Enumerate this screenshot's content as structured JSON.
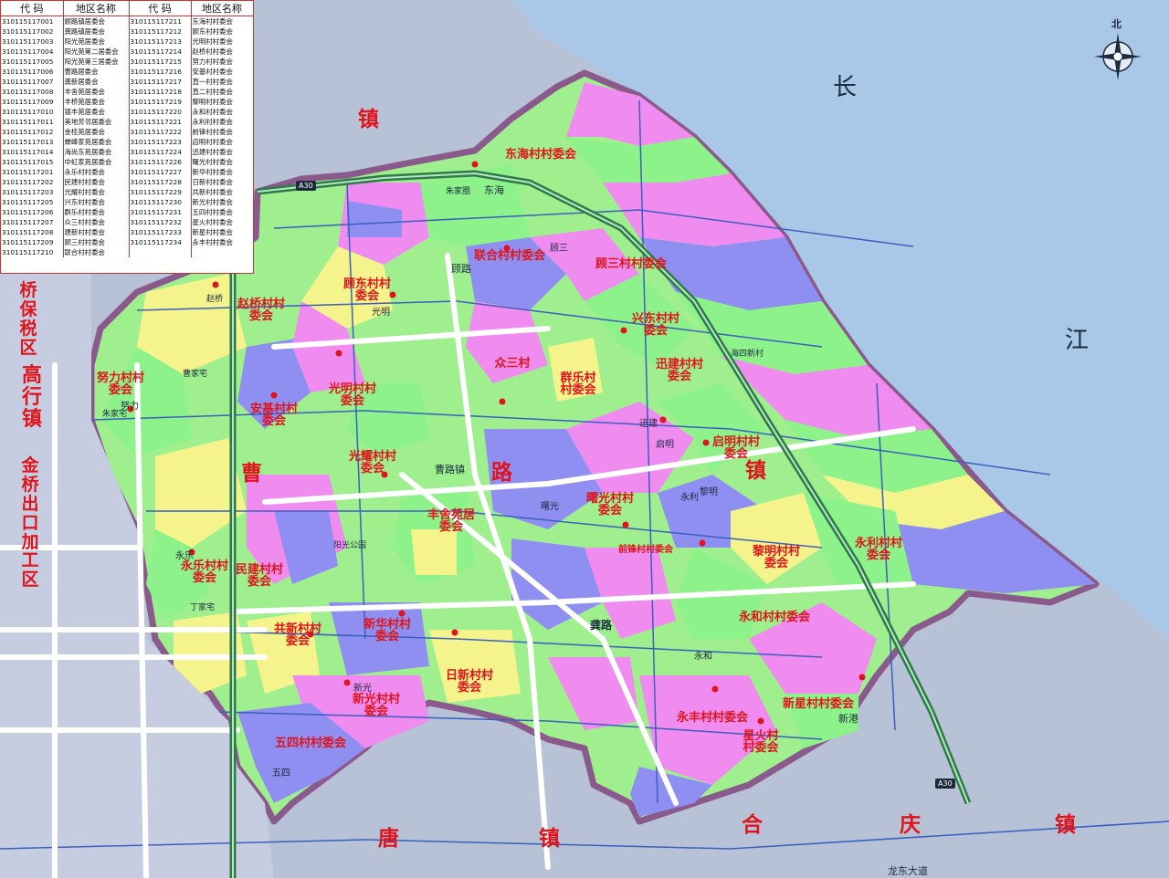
{
  "legend": {
    "headers": [
      "代 码",
      "地区名称",
      "代 码",
      "地区名称"
    ],
    "rows": [
      [
        "310115117001",
        "顾路镇居委会",
        "310115117211",
        "东海村村委会"
      ],
      [
        "310115117002",
        "龚路镇居委会",
        "310115117212",
        "顾东村村委会"
      ],
      [
        "310115117003",
        "阳光苑居委会",
        "310115117213",
        "光明村村委会"
      ],
      [
        "310115117004",
        "阳光苑第二居委会",
        "310115117214",
        "赵桥村村委会"
      ],
      [
        "310115117005",
        "阳光苑第三居委会",
        "310115117215",
        "努力村村委会"
      ],
      [
        "310115117006",
        "曹路居委会",
        "310115117216",
        "安基村村委会"
      ],
      [
        "310115117007",
        "龚新居委会",
        "310115117217",
        "直一村村委会"
      ],
      [
        "310115117008",
        "丰舍苑居委会",
        "310115117218",
        "直二村村委会"
      ],
      [
        "310115117009",
        "丰桥苑居委会",
        "310115117219",
        "黎明村村委会"
      ],
      [
        "310115117010",
        "银丰苑居委会",
        "310115117220",
        "永和村村委会"
      ],
      [
        "310115117011",
        "美地芳邻居委会",
        "310115117221",
        "永利村村委会"
      ],
      [
        "310115117012",
        "金桂苑居委会",
        "310115117222",
        "前锋村村委会"
      ],
      [
        "310115117013",
        "蝉峰家苑居委会",
        "310115117223",
        "启明村村委会"
      ],
      [
        "310115117014",
        "海尚东苑居委会",
        "310115117224",
        "迅建村村委会"
      ],
      [
        "310115117015",
        "中虹家苑居委会",
        "310115117226",
        "曙光村村委会"
      ],
      [
        "310115117201",
        "永乐村村委会",
        "310115117227",
        "新华村村委会"
      ],
      [
        "310115117202",
        "民建村村委会",
        "310115117228",
        "日新村村委会"
      ],
      [
        "310115117203",
        "光耀村村委会",
        "310115117229",
        "共新村村委会"
      ],
      [
        "310115117205",
        "兴东村村委会",
        "310115117230",
        "新光村村委会"
      ],
      [
        "310115117206",
        "群乐村村委会",
        "310115117231",
        "五四村村委会"
      ],
      [
        "310115117207",
        "众三村村委会",
        "310115117232",
        "星火村村委会"
      ],
      [
        "310115117208",
        "建新村村委会",
        "310115117233",
        "新星村村委会"
      ],
      [
        "310115117209",
        "顾三村村委会",
        "310115117234",
        "永丰村村委会"
      ],
      [
        "310115117210",
        "联合村村委会",
        "",
        ""
      ]
    ]
  },
  "compass": {
    "label": "北"
  },
  "river": {
    "chars": [
      "长",
      "江"
    ]
  },
  "neighbors": {
    "left_column_1": "桥保税区",
    "left_column_2": "高行镇",
    "left_column_3": "金桥出口加工区",
    "north": "镇",
    "south": [
      "唐",
      "镇",
      "合",
      "庆",
      "镇"
    ]
  },
  "center_label": [
    "曹",
    "路",
    "镇"
  ],
  "villages": [
    {
      "name": "东海村村委会"
    },
    {
      "name": "联合村村委会"
    },
    {
      "name": "顾三村村委会"
    },
    {
      "name": "顾东村村委会"
    },
    {
      "name": "赵桥村村委会"
    },
    {
      "name": "兴东村村委会"
    },
    {
      "name": "光明村村委会"
    },
    {
      "name": "努力村村委会"
    },
    {
      "name": "迅建村村委会"
    },
    {
      "name": "安基村村委会"
    },
    {
      "name": "众三村"
    },
    {
      "name": "群乐村村委会"
    },
    {
      "name": "启明村村委会"
    },
    {
      "name": "光耀村村委会"
    },
    {
      "name": "曙光村村委会"
    },
    {
      "name": "丰舍苑居委会"
    },
    {
      "name": "永乐村村委会"
    },
    {
      "name": "民建村村委会"
    },
    {
      "name": "黎明村村委会"
    },
    {
      "name": "永利村村委会"
    },
    {
      "name": "共新村村委会"
    },
    {
      "name": "新华村村委会"
    },
    {
      "name": "永和村村委会"
    },
    {
      "name": "日新村村委会"
    },
    {
      "name": "新光村村委会"
    },
    {
      "name": "新星村村委会"
    },
    {
      "name": "永丰村村委会"
    },
    {
      "name": "五四村村委会"
    },
    {
      "name": "星火村村委会"
    },
    {
      "name": "前锋村村委会"
    }
  ],
  "places": [
    {
      "name": "朱家圈"
    },
    {
      "name": "东海"
    },
    {
      "name": "顾路"
    },
    {
      "name": "光明"
    },
    {
      "name": "曹家宅"
    },
    {
      "name": "朱家宅"
    },
    {
      "name": "曹路镇"
    },
    {
      "name": "阳光公园"
    },
    {
      "name": "龚路"
    },
    {
      "name": "新港"
    },
    {
      "name": "永利"
    },
    {
      "name": "黎明"
    },
    {
      "name": "曙光"
    },
    {
      "name": "永乐"
    },
    {
      "name": "五四"
    },
    {
      "name": "新光"
    },
    {
      "name": "永和"
    },
    {
      "name": "启明"
    },
    {
      "name": "迅建"
    },
    {
      "name": "海四新村"
    },
    {
      "name": "努力"
    },
    {
      "name": "赵桥"
    },
    {
      "name": "顾三"
    },
    {
      "name": "丁家宅"
    }
  ],
  "roads": {
    "a30_shield": "A30",
    "south_road": "龙东大道"
  },
  "colors": {
    "water": "#a9c7e6",
    "outside": "#b7c2d6",
    "boundary": "#8a5a8c",
    "green": "#8df28a",
    "pink": "#f08cf0",
    "purple": "#8f8ff2",
    "yellow": "#f4f38c",
    "label_red": "#e0141c",
    "expressway": "#2f7a4a"
  }
}
